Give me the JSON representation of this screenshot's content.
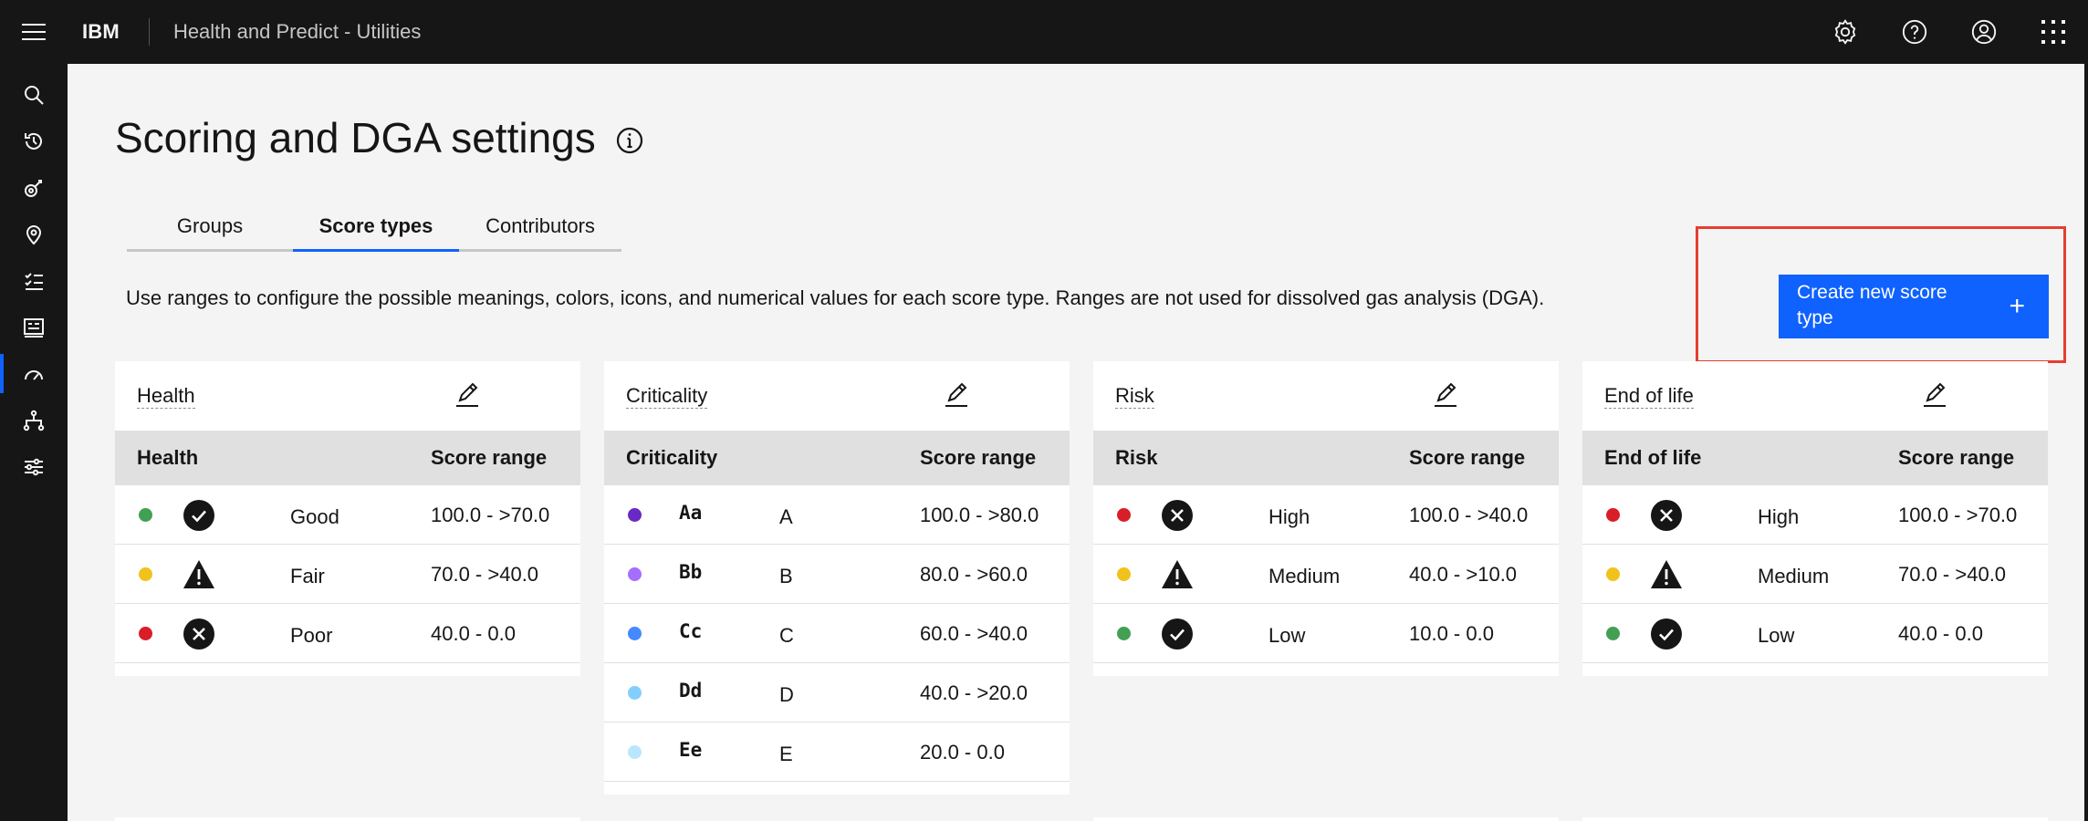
{
  "header": {
    "brand": "IBM",
    "app_title": "Health and Predict - Utilities",
    "icons": [
      "settings-icon",
      "help-icon",
      "user-avatar-icon",
      "app-switcher-icon"
    ]
  },
  "sidenav": {
    "items": [
      "search-icon",
      "recent-history-icon",
      "satellite-icon",
      "location-icon",
      "checklist-icon",
      "dashboard-icon",
      "meter-icon",
      "hierarchy-icon",
      "settings-adjust-icon"
    ],
    "active_index": 6
  },
  "page": {
    "title": "Scoring and DGA settings",
    "tabs": [
      {
        "label": "Groups",
        "active": false
      },
      {
        "label": "Score types",
        "active": true
      },
      {
        "label": "Contributors",
        "active": false
      }
    ],
    "description": "Use ranges to configure the possible meanings, colors, icons, and numerical values for each score type. Ranges are not used for dissolved gas analysis (DGA).",
    "create_button": {
      "label": "Create new score type",
      "icon": "add-icon"
    }
  },
  "colors": {
    "accent": "#0f62fe",
    "highlight": "#e53e2f",
    "green": "#42a053",
    "yellow": "#f1c21b",
    "red": "#da1e28",
    "purple_dark": "#6929c4",
    "purple_light": "#a56eff",
    "blue": "#4589ff",
    "blue_light": "#82cfff",
    "blue_pale": "#bae6ff"
  },
  "cards": [
    {
      "title": "Health",
      "col1": "Health",
      "col2": "Score range",
      "rows": [
        {
          "color": "#42a053",
          "icon": "checkmark-icon",
          "meaning": "Good",
          "range": "100.0 - >70.0"
        },
        {
          "color": "#f1c21b",
          "icon": "warning-icon",
          "meaning": "Fair",
          "range": "70.0 - >40.0"
        },
        {
          "color": "#da1e28",
          "icon": "error-icon",
          "meaning": "Poor",
          "range": "40.0 - 0.0"
        }
      ]
    },
    {
      "title": "Criticality",
      "col1": "Criticality",
      "col2": "Score range",
      "rows": [
        {
          "color": "#6929c4",
          "symbol": "Aa",
          "meaning": "A",
          "range": "100.0 - >80.0"
        },
        {
          "color": "#a56eff",
          "symbol": "Bb",
          "meaning": "B",
          "range": "80.0 - >60.0"
        },
        {
          "color": "#4589ff",
          "symbol": "Cc",
          "meaning": "C",
          "range": "60.0 - >40.0"
        },
        {
          "color": "#82cfff",
          "symbol": "Dd",
          "meaning": "D",
          "range": "40.0 - >20.0"
        },
        {
          "color": "#bae6ff",
          "symbol": "Ee",
          "meaning": "E",
          "range": "20.0 - 0.0"
        }
      ]
    },
    {
      "title": "Risk",
      "col1": "Risk",
      "col2": "Score range",
      "rows": [
        {
          "color": "#da1e28",
          "icon": "error-icon",
          "meaning": "High",
          "range": "100.0 - >40.0"
        },
        {
          "color": "#f1c21b",
          "icon": "warning-icon",
          "meaning": "Medium",
          "range": "40.0 - >10.0"
        },
        {
          "color": "#42a053",
          "icon": "checkmark-icon",
          "meaning": "Low",
          "range": "10.0 - 0.0"
        }
      ]
    },
    {
      "title": "End of life",
      "col1": "End of life",
      "col2": "Score range",
      "rows": [
        {
          "color": "#da1e28",
          "icon": "error-icon",
          "meaning": "High",
          "range": "100.0 - >70.0"
        },
        {
          "color": "#f1c21b",
          "icon": "warning-icon",
          "meaning": "Medium",
          "range": "70.0 - >40.0"
        },
        {
          "color": "#42a053",
          "icon": "checkmark-icon",
          "meaning": "Low",
          "range": "40.0 - 0.0"
        }
      ]
    }
  ]
}
